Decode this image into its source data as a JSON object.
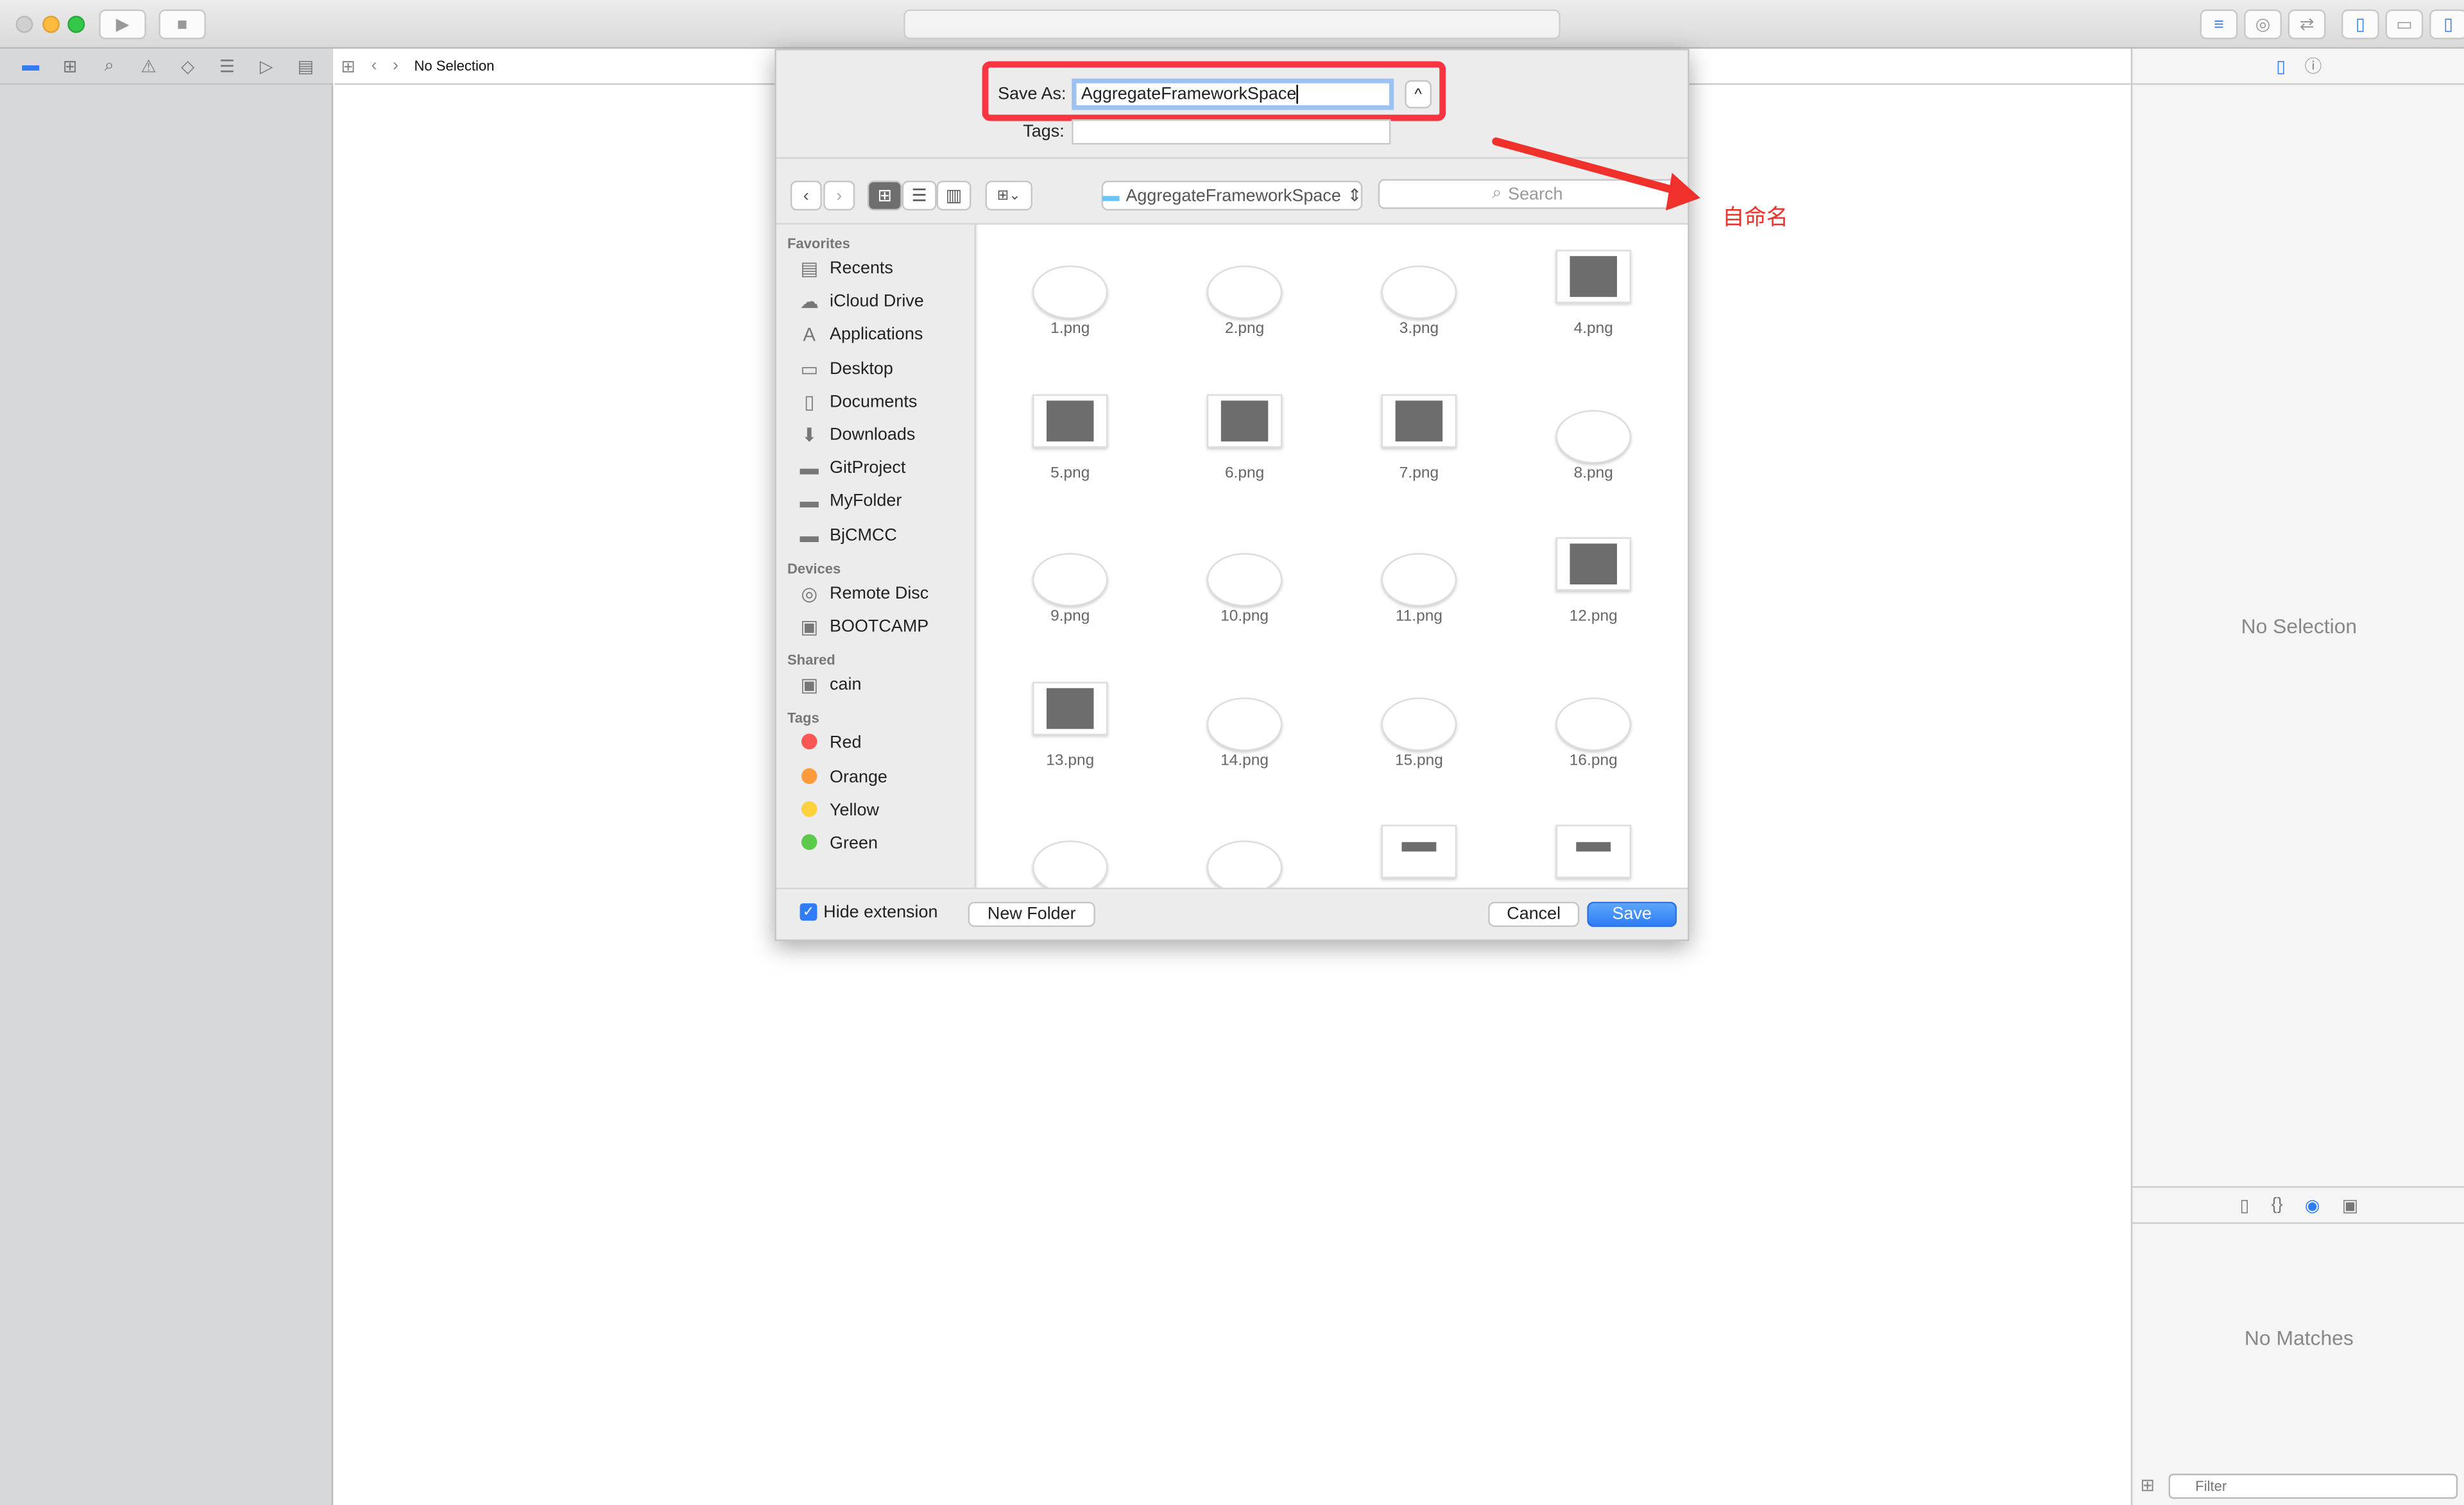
{
  "toolbar": {
    "play": "▶",
    "stop": "■"
  },
  "jumpbar": {
    "title": "No Selection"
  },
  "inspector": {
    "no_selection": "No Selection",
    "no_matches": "No Matches",
    "filter_placeholder": "Filter"
  },
  "dialog": {
    "save_as_label": "Save As:",
    "save_as_value": "AggregateFrameworkSpace",
    "tags_label": "Tags:",
    "location": "AggregateFrameworkSpace",
    "search_placeholder": "Search",
    "hide_extension_label": "Hide extension",
    "hide_extension_checked": true,
    "new_folder": "New Folder",
    "cancel": "Cancel",
    "save": "Save",
    "sidebar": {
      "favorites_heading": "Favorites",
      "favorites": [
        {
          "label": "Recents",
          "icon": "recents-icon"
        },
        {
          "label": "iCloud Drive",
          "icon": "cloud-icon"
        },
        {
          "label": "Applications",
          "icon": "applications-icon"
        },
        {
          "label": "Desktop",
          "icon": "desktop-icon"
        },
        {
          "label": "Documents",
          "icon": "documents-icon"
        },
        {
          "label": "Downloads",
          "icon": "downloads-icon"
        },
        {
          "label": "GitProject",
          "icon": "folder-icon"
        },
        {
          "label": "MyFolder",
          "icon": "folder-icon"
        },
        {
          "label": "BjCMCC",
          "icon": "folder-icon"
        }
      ],
      "devices_heading": "Devices",
      "devices": [
        {
          "label": "Remote Disc",
          "icon": "disc-icon"
        },
        {
          "label": "BOOTCAMP",
          "icon": "drive-icon"
        }
      ],
      "shared_heading": "Shared",
      "shared": [
        {
          "label": "cain",
          "icon": "computer-icon"
        }
      ],
      "tags_heading": "Tags",
      "tags": [
        {
          "label": "Red",
          "color": "#fc5753"
        },
        {
          "label": "Orange",
          "color": "#fd9a3b"
        },
        {
          "label": "Yellow",
          "color": "#fdd13e"
        },
        {
          "label": "Green",
          "color": "#5bc94c"
        }
      ]
    },
    "files": [
      {
        "name": "1.png",
        "thumb": "light"
      },
      {
        "name": "2.png",
        "thumb": "light"
      },
      {
        "name": "3.png",
        "thumb": "light"
      },
      {
        "name": "4.png",
        "thumb": "dark"
      },
      {
        "name": "5.png",
        "thumb": "dark"
      },
      {
        "name": "6.png",
        "thumb": "dark"
      },
      {
        "name": "7.png",
        "thumb": "dark"
      },
      {
        "name": "8.png",
        "thumb": "light"
      },
      {
        "name": "9.png",
        "thumb": "light"
      },
      {
        "name": "10.png",
        "thumb": "light"
      },
      {
        "name": "11.png",
        "thumb": "light"
      },
      {
        "name": "12.png",
        "thumb": "dark"
      },
      {
        "name": "13.png",
        "thumb": "dark"
      },
      {
        "name": "14.png",
        "thumb": "light"
      },
      {
        "name": "15.png",
        "thumb": "light"
      },
      {
        "name": "16.png",
        "thumb": "light"
      },
      {
        "name": "",
        "thumb": "light"
      },
      {
        "name": "",
        "thumb": "light"
      },
      {
        "name": "",
        "thumb": "mixed"
      },
      {
        "name": "",
        "thumb": "mixed"
      }
    ]
  },
  "annotation": {
    "text": "自命名",
    "color": "#f0302a"
  },
  "colors": {
    "accent": "#2f7cf6",
    "highlight": "#fb3441"
  }
}
